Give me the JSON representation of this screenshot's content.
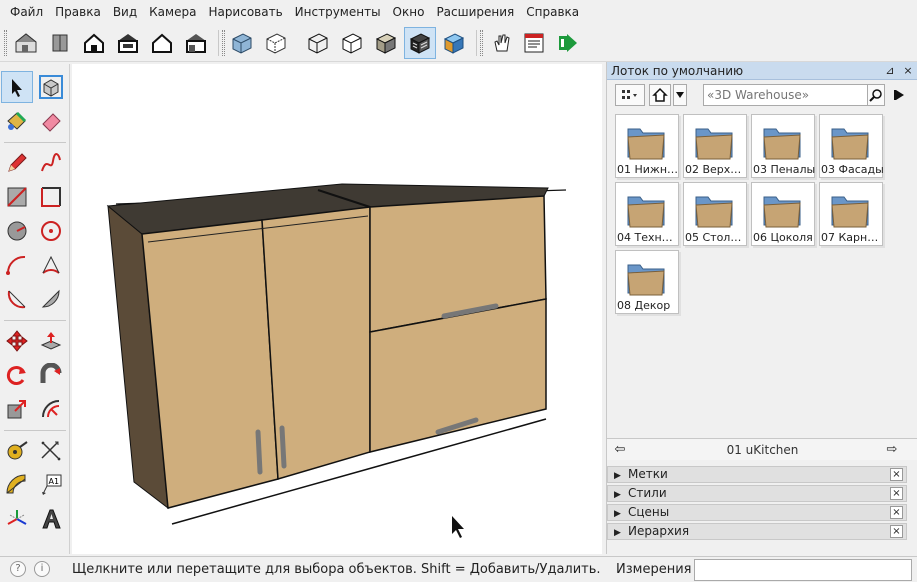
{
  "menu": {
    "items": [
      {
        "label": "Файл"
      },
      {
        "label": "Правка"
      },
      {
        "label": "Вид"
      },
      {
        "label": "Камера"
      },
      {
        "label": "Нарисовать"
      },
      {
        "label": "Инструменты"
      },
      {
        "label": "Окно"
      },
      {
        "label": "Расширения"
      },
      {
        "label": "Справка"
      }
    ]
  },
  "toolbar": {
    "buttons": [
      {
        "icon": "iso-view-icon"
      },
      {
        "icon": "top-view-icon"
      },
      {
        "icon": "front-view-icon"
      },
      {
        "icon": "right-view-icon"
      },
      {
        "icon": "back-view-icon"
      },
      {
        "icon": "left-view-icon"
      },
      {
        "icon": "xray-style-icon"
      },
      {
        "icon": "back-edges-style-icon"
      },
      {
        "icon": "wireframe-style-icon"
      },
      {
        "icon": "hidden-line-style-icon"
      },
      {
        "icon": "shaded-style-icon"
      },
      {
        "icon": "shaded-textures-style-icon",
        "active": true
      },
      {
        "icon": "monochrome-style-icon"
      },
      {
        "icon": "hand-tool-icon"
      },
      {
        "icon": "report-icon"
      },
      {
        "icon": "green-arrow-icon"
      }
    ]
  },
  "tools": [
    {
      "icon": "select-arrow-icon",
      "active": true
    },
    {
      "icon": "make-component-icon"
    },
    {
      "icon": "paint-bucket-icon"
    },
    {
      "icon": "eraser-icon"
    },
    {
      "icon": "pencil-line-icon"
    },
    {
      "icon": "freehand-icon"
    },
    {
      "icon": "rectangle-icon"
    },
    {
      "icon": "rotated-rectangle-icon"
    },
    {
      "icon": "circle-icon"
    },
    {
      "icon": "polygon-icon"
    },
    {
      "icon": "arc-icon"
    },
    {
      "icon": "two-point-arc-icon"
    },
    {
      "icon": "three-point-arc-icon"
    },
    {
      "icon": "pie-icon"
    },
    {
      "icon": "move-icon"
    },
    {
      "icon": "push-pull-icon"
    },
    {
      "icon": "rotate-icon"
    },
    {
      "icon": "follow-me-icon"
    },
    {
      "icon": "scale-icon"
    },
    {
      "icon": "offset-icon"
    },
    {
      "icon": "tape-measure-icon"
    },
    {
      "icon": "dimension-icon"
    },
    {
      "icon": "protractor-icon"
    },
    {
      "icon": "text-label-icon",
      "text": "A1"
    },
    {
      "icon": "axes-icon"
    },
    {
      "icon": "3d-text-icon"
    }
  ],
  "tray": {
    "title": "Лоток по умолчанию",
    "pin": "⊿",
    "close": "×",
    "search_placeholder": "«3D Warehouse»",
    "components": [
      {
        "label": "01 Нижн…"
      },
      {
        "label": "02 Верх…"
      },
      {
        "label": "03 Пеналы"
      },
      {
        "label": "03 Фасады"
      },
      {
        "label": "04 Техн…"
      },
      {
        "label": "05 Стол…"
      },
      {
        "label": "06 Цоколя"
      },
      {
        "label": "07 Карн…"
      },
      {
        "label": "08 Декор"
      }
    ],
    "collection": "01 uKitchen",
    "panels": [
      {
        "label": "Метки"
      },
      {
        "label": "Стили"
      },
      {
        "label": "Сцены"
      },
      {
        "label": "Иерархия"
      }
    ]
  },
  "status": {
    "message": "Щелкните или перетащите для выбора объектов. Shift = Добавить/Удалить. Ctrl = Д...",
    "measurements_label": "Измерения",
    "measurements_value": ""
  },
  "colors": {
    "cabinet_front": "#cfae7d",
    "cabinet_side": "#5b4b38",
    "cabinet_top": "#3f3a33",
    "accent_selection": "#cfe3f5"
  }
}
